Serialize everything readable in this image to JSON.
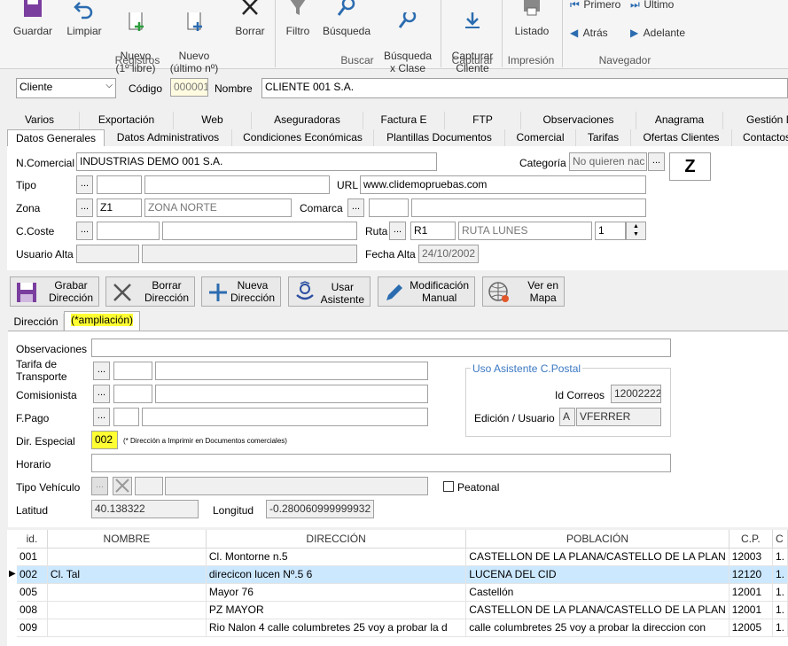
{
  "ribbon": {
    "registros": {
      "label": "Registros",
      "buttons": [
        {
          "label": "Guardar"
        },
        {
          "label": "Limpiar"
        },
        {
          "label": "Nuevo\n(1º libre)"
        },
        {
          "label": "Nuevo\n(último nº)"
        },
        {
          "label": "Borrar"
        }
      ]
    },
    "buscar": {
      "label": "Buscar",
      "buttons": [
        {
          "label": "Filtro"
        },
        {
          "label": "Búsqueda"
        },
        {
          "label": "Búsqueda\nx Clase"
        }
      ]
    },
    "capturar": {
      "label": "Capturar",
      "button": "Capturar\nCliente"
    },
    "impresion": {
      "label": "Impresión",
      "button": "Listado"
    },
    "navegador": {
      "label": "Navegador",
      "primero": "Primero",
      "ultimo": "Último",
      "atras": "Atrás",
      "adelante": "Adelante"
    }
  },
  "header": {
    "type_value": "Cliente",
    "codigo_label": "Código",
    "codigo_value": "000001",
    "nombre_label": "Nombre",
    "nombre_value": "CLIENTE 001 S.A."
  },
  "tabs_top": [
    "Varios",
    "Exportación",
    "Web",
    "Aseguradoras",
    "Factura E",
    "FTP",
    "Observaciones",
    "Anagrama",
    "Gestión D"
  ],
  "tabs_main": [
    "Datos Generales",
    "Datos Administrativos",
    "Condiciones Económicas",
    "Plantillas Documentos",
    "Comercial",
    "Tarifas",
    "Ofertas Clientes",
    "Contactos"
  ],
  "general": {
    "ncomercial_label": "N.Comercial",
    "ncomercial_value": "INDUSTRIAS DEMO 001  S.A.",
    "categoria_label": "Categoría",
    "categoria_value": "No quieren nac",
    "categoria_badge": "Z",
    "tipo_label": "Tipo",
    "url_label": "URL",
    "url_value": "www.clidemopruebas.com",
    "zona_label": "Zona",
    "zona_code": "Z1",
    "zona_name": "ZONA NORTE",
    "comarca_label": "Comarca",
    "ccoste_label": "C.Coste",
    "ruta_label": "Ruta",
    "ruta_code": "R1",
    "ruta_name": "RUTA LUNES",
    "ruta_num": "1",
    "usuario_alta_label": "Usuario Alta",
    "fecha_alta_label": "Fecha Alta",
    "fecha_alta_value": "24/10/2002"
  },
  "actions": {
    "grabar": "Grabar\nDirección",
    "borrar": "Borrar\nDirección",
    "nueva": "Nueva\nDirección",
    "asistente": "Usar\nAsistente",
    "modificacion": "Modificación\nManual",
    "mapa": "Ver en\nMapa"
  },
  "subtabs": [
    "Dirección",
    "(*ampliación)"
  ],
  "ampliacion": {
    "observaciones_label": "Observaciones",
    "tarifa_label": "Tarifa de\nTransporte",
    "comisionista_label": "Comisionista",
    "fpago_label": "F.Pago",
    "dir_especial_label": "Dir. Especial",
    "dir_especial_value": "002",
    "dir_especial_note": "(* Dirección a Imprimir en Documentos comerciales)",
    "horario_label": "Horario",
    "tipo_vehiculo_label": "Tipo Vehículo",
    "peatonal_label": "Peatonal",
    "latitud_label": "Latitud",
    "latitud_value": "40.138322",
    "longitud_label": "Longitud",
    "longitud_value": "-0.280060999999932",
    "postal_title": "Uso Asistente C.Postal",
    "id_correos_label": "Id Correos",
    "id_correos_value": "12002222",
    "edicion_label": "Edición / Usuario",
    "edicion_flag": "A",
    "edicion_user": "VFERRER"
  },
  "table": {
    "headers": [
      "id.",
      "NOMBRE",
      "DIRECCIÓN",
      "POBLACIÓN",
      "C.P.",
      "C"
    ],
    "rows": [
      {
        "id": "001",
        "nombre": "",
        "direccion": "Cl. Montorne n.5",
        "poblacion": "CASTELLON DE LA PLANA/CASTELLO DE LA PLAN",
        "cp": "12003",
        "c": "1."
      },
      {
        "id": "002",
        "nombre": "Cl. Tal",
        "direccion": "direcicon lucen Nº.5 6",
        "poblacion": "LUCENA DEL CID",
        "cp": "12120",
        "c": "1."
      },
      {
        "id": "005",
        "nombre": "",
        "direccion": "Mayor 76",
        "poblacion": "Castellón",
        "cp": "12001",
        "c": "1."
      },
      {
        "id": "008",
        "nombre": "",
        "direccion": "PZ MAYOR",
        "poblacion": "CASTELLON DE LA PLANA/CASTELLO DE LA PLAN",
        "cp": "12001",
        "c": "1."
      },
      {
        "id": "009",
        "nombre": "",
        "direccion": "Rio Nalon 4 calle columbretes 25 voy a probar la d",
        "poblacion": "calle columbretes 25 voy a probar la direccion con",
        "cp": "12005",
        "c": "1."
      }
    ]
  },
  "colors": {
    "accent": "#2b6cb0",
    "highlight": "#ffff33",
    "selected_row": "#cce8ff"
  }
}
